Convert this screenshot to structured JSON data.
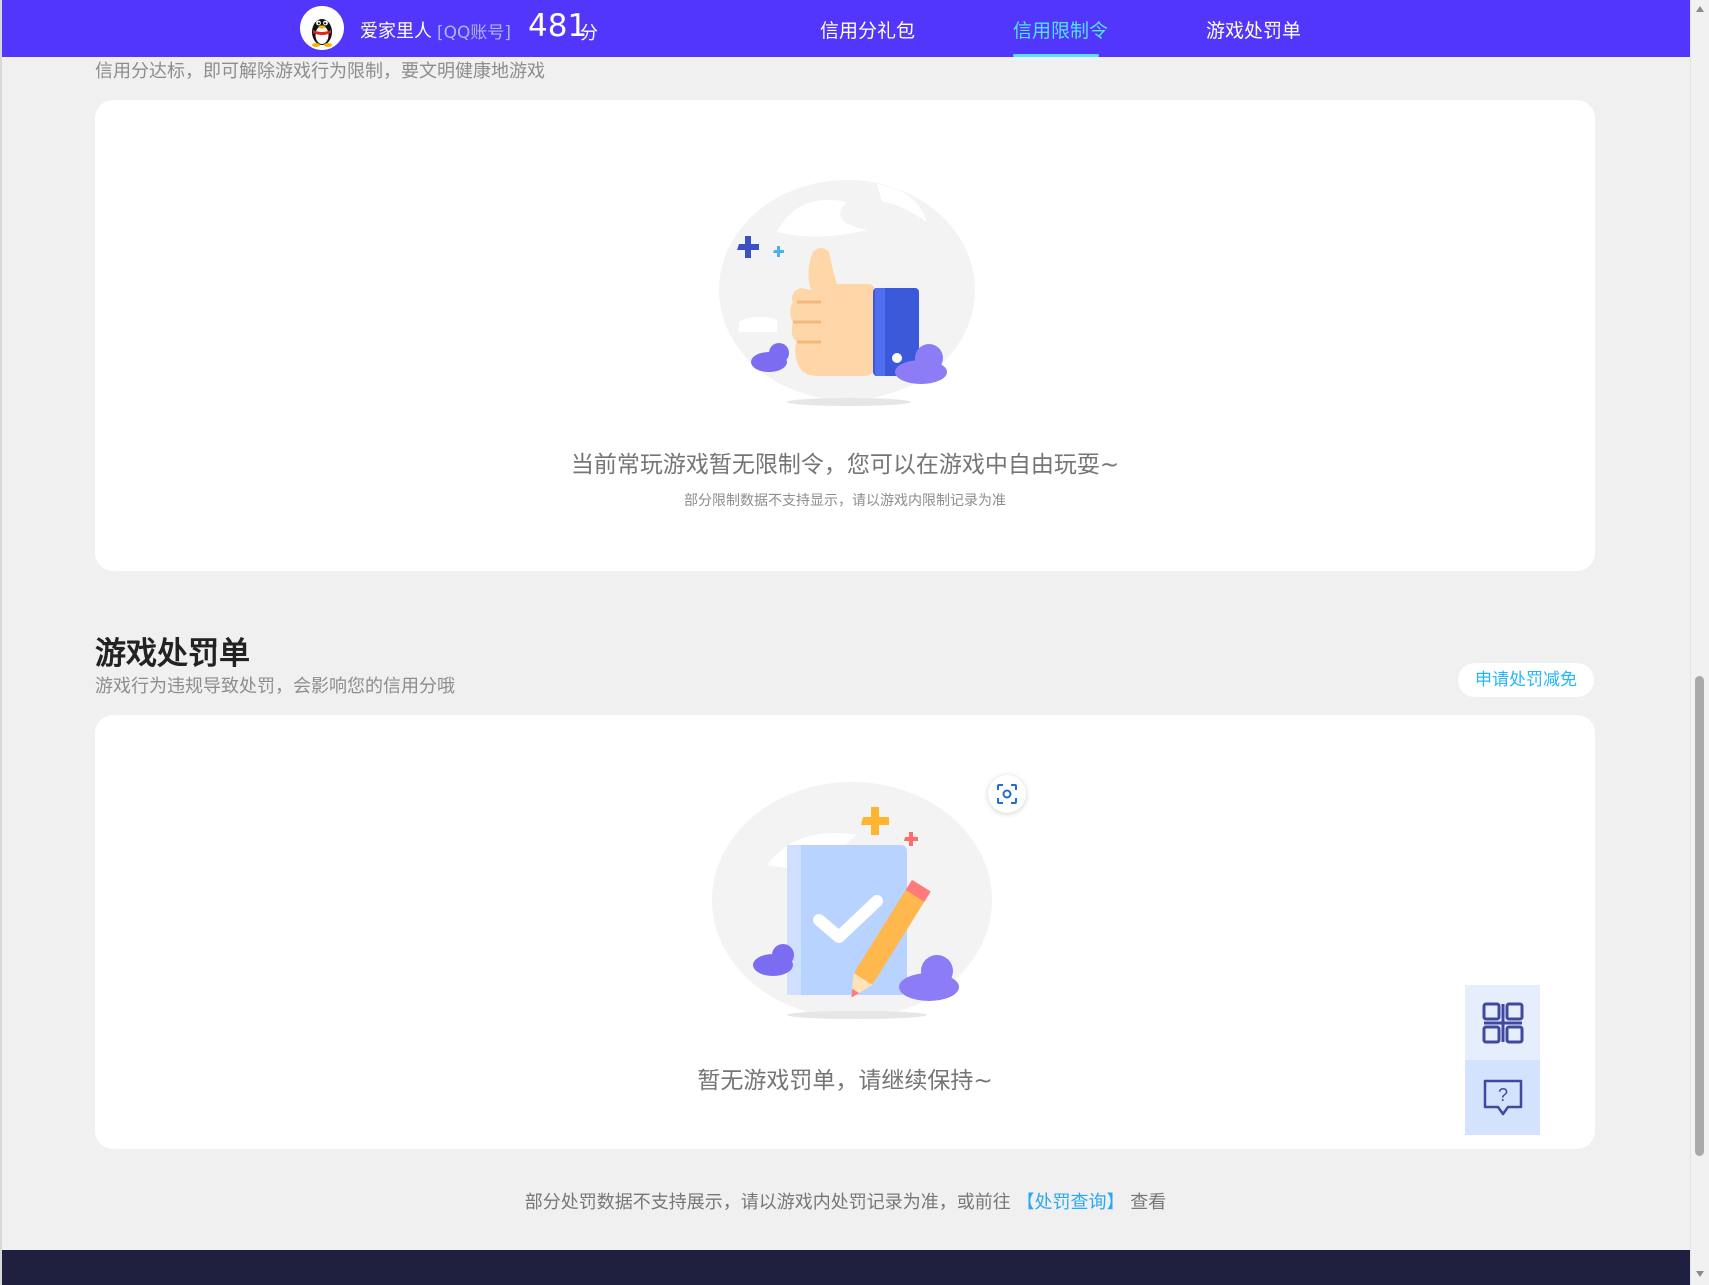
{
  "header": {
    "user_name": "爱家里人",
    "account_type": "[QQ账号]",
    "score_value": "481",
    "score_unit": "分",
    "nav": [
      {
        "label": "信用分礼包",
        "active": false
      },
      {
        "label": "信用限制令",
        "active": true
      },
      {
        "label": "游戏处罚单",
        "active": false
      }
    ],
    "colors": {
      "bar": "#5236fb",
      "active_tab": "#53e3ff"
    }
  },
  "restriction_section": {
    "description": "信用分达标，即可解除游戏行为限制，要文明健康地游戏",
    "empty_title": "当前常玩游戏暂无限制令，您可以在游戏中自由玩耍~",
    "empty_subtitle": "部分限制数据不支持显示，请以游戏内限制记录为准",
    "illustration_icon": "thumbs-up-illustration"
  },
  "penalty_section": {
    "title": "游戏处罚单",
    "description": "游戏行为违规导致处罚，会影响您的信用分哦",
    "appeal_button": "申请处罚减免",
    "empty_title": "暂无游戏罚单，请继续保持~",
    "illustration_icon": "checked-document-pencil-illustration"
  },
  "footer": {
    "note_prefix": "部分处罚数据不支持展示，请以游戏内处罚记录为准，或前往",
    "link_label": "【处罚查询】",
    "note_suffix": "查看"
  },
  "floating_tools": {
    "qr_icon": "qr-code-icon",
    "help_icon": "help-chat-icon"
  }
}
